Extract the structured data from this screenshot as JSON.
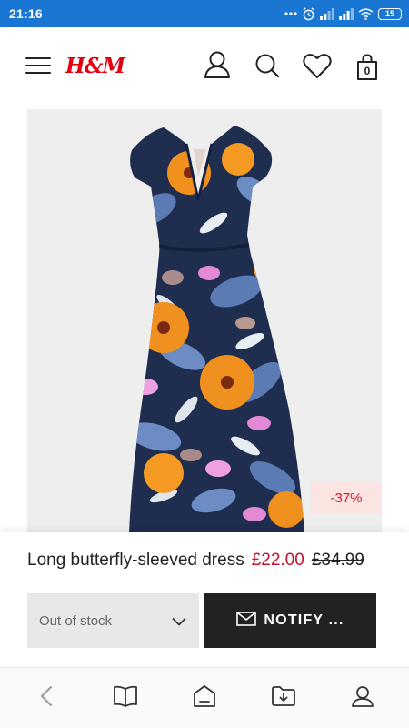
{
  "status_bar": {
    "time": "21:16",
    "battery_level": "15",
    "icons": [
      "more-dots-icon",
      "alarm-icon",
      "signal-icon",
      "signal-icon",
      "wifi-icon",
      "battery-icon"
    ]
  },
  "header": {
    "logo_text": "H&M",
    "icons": [
      "menu-icon",
      "account-icon",
      "search-icon",
      "favorites-heart-icon",
      "shopping-bag-icon"
    ],
    "bag_count": "0",
    "brand_color": "#e50010"
  },
  "product": {
    "image": "floral-maxi-dress-image",
    "discount_badge": "-37%",
    "name": "Long butterfly-sleeved dress",
    "price_current": "£22.00",
    "price_old": "£34.99",
    "sale_color": "#c8102e"
  },
  "actions": {
    "size_select_value": "Out of stock",
    "notify_label": "NOTIFY ..."
  },
  "bottom_nav": {
    "items": [
      "back-icon",
      "bookmarks-book-icon",
      "home-icon",
      "downloads-folder-icon",
      "profile-icon"
    ]
  }
}
